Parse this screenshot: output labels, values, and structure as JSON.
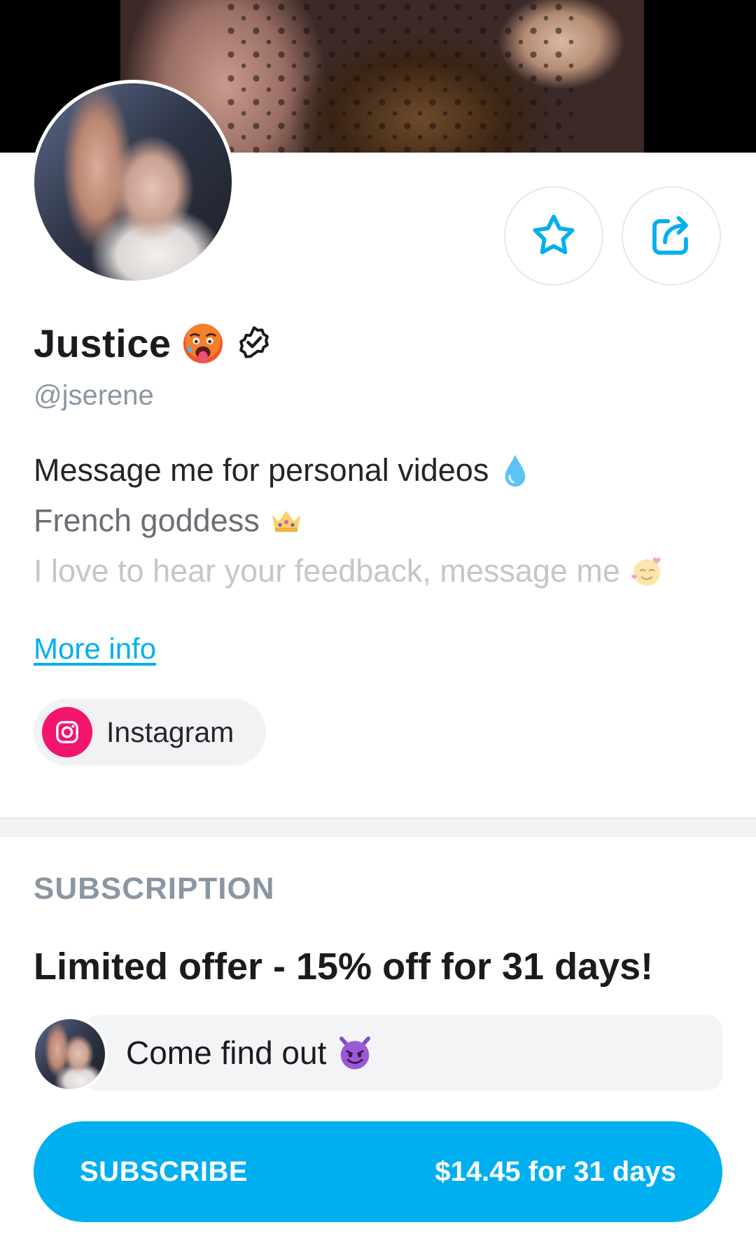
{
  "profile": {
    "name": "Justice",
    "handle": "@jserene",
    "bio": [
      "Message me for personal videos",
      "French goddess",
      "I love to hear your feedback, message me"
    ],
    "more_info_label": "More info",
    "social_link_label": "Instagram"
  },
  "subscription": {
    "heading": "SUBSCRIPTION",
    "offer_title": "Limited offer - 15% off for 31 days!",
    "message": "Come find out",
    "button_label": "SUBSCRIBE",
    "button_price": "$14.45 for 31 days"
  },
  "icons": {
    "favorite": "star-icon",
    "share": "share-icon",
    "verified": "verified-badge-icon",
    "instagram": "instagram-icon"
  },
  "colors": {
    "accent": "#00aff0",
    "instagram": "#f2146d",
    "muted_text": "#8a96a3"
  }
}
